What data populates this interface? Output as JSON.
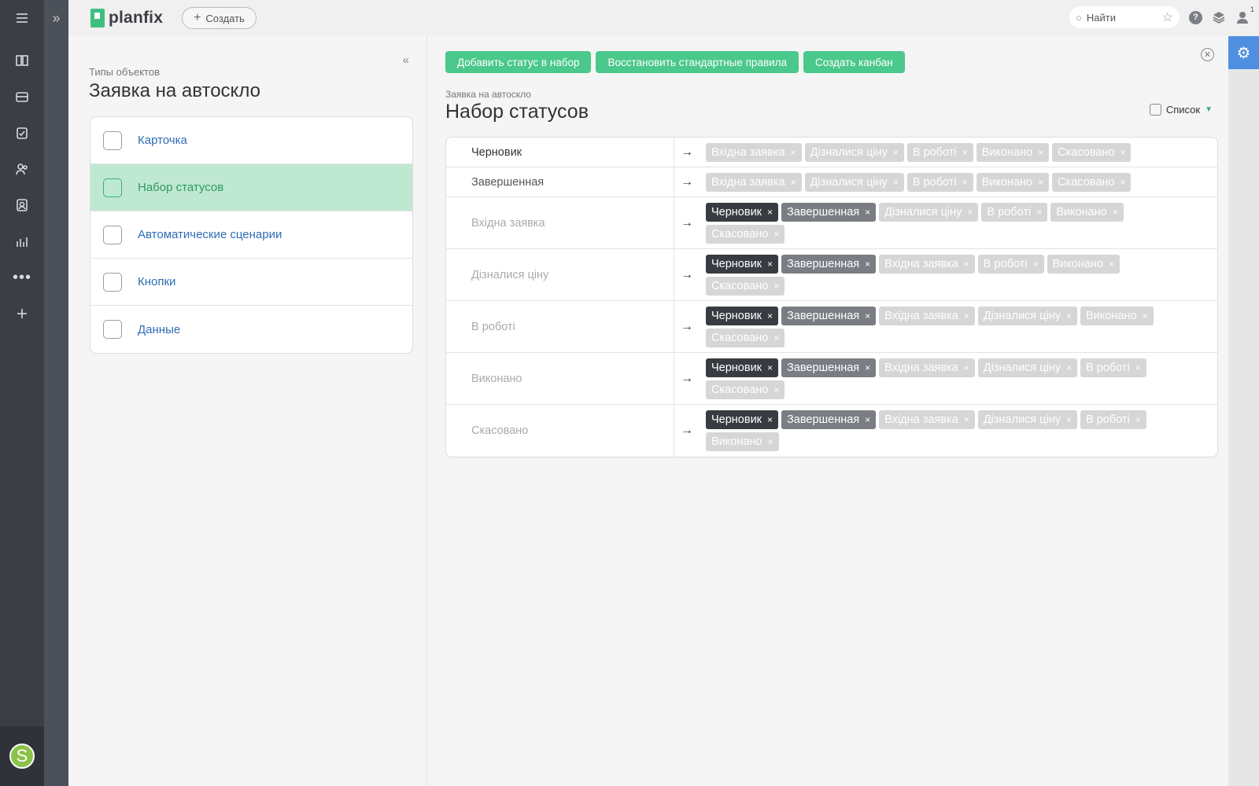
{
  "rail": {
    "items": [
      "menu-icon",
      "pages-icon",
      "inbox-icon",
      "tasks-icon",
      "contacts-icon",
      "users-icon",
      "reports-icon",
      "more-icon",
      "add-icon"
    ],
    "avatar_letter": "S"
  },
  "topbar": {
    "logo": "planfix",
    "create_label": "Создать",
    "search_placeholder": "Найти",
    "user_badge": "1"
  },
  "left": {
    "subtitle": "Типы объектов",
    "title": "Заявка на автоскло",
    "menu": [
      {
        "label": "Карточка",
        "icon": "card-icon",
        "active": false
      },
      {
        "label": "Набор статусов",
        "icon": "statuses-icon",
        "active": true
      },
      {
        "label": "Автоматические сценарии",
        "icon": "scenario-icon",
        "active": false
      },
      {
        "label": "Кнопки",
        "icon": "buttons-icon",
        "active": false
      },
      {
        "label": "Данные",
        "icon": "data-icon",
        "active": false
      }
    ]
  },
  "main": {
    "buttons": {
      "add_status": "Добавить статус в набор",
      "restore": "Восстановить стандартные правила",
      "kanban": "Создать канбан"
    },
    "subtitle": "Заявка на автоскло",
    "title": "Набор статусов",
    "view_label": "Список",
    "rows": [
      {
        "name": "Черновик",
        "tone": "dark",
        "tags": [
          {
            "label": "Вхідна заявка",
            "style": "light"
          },
          {
            "label": "Дізналися ціну",
            "style": "light"
          },
          {
            "label": "В роботі",
            "style": "light"
          },
          {
            "label": "Виконано",
            "style": "light"
          },
          {
            "label": "Скасовано",
            "style": "light"
          }
        ]
      },
      {
        "name": "Завершенная",
        "tone": "mid",
        "tags": [
          {
            "label": "Вхідна заявка",
            "style": "light"
          },
          {
            "label": "Дізналися ціну",
            "style": "light"
          },
          {
            "label": "В роботі",
            "style": "light"
          },
          {
            "label": "Виконано",
            "style": "light"
          },
          {
            "label": "Скасовано",
            "style": "light"
          }
        ]
      },
      {
        "name": "Вхідна заявка",
        "tone": "light",
        "tags": [
          {
            "label": "Черновик",
            "style": "black"
          },
          {
            "label": "Завершенная",
            "style": "grey"
          },
          {
            "label": "Дізналися ціну",
            "style": "light"
          },
          {
            "label": "В роботі",
            "style": "light"
          },
          {
            "label": "Виконано",
            "style": "light"
          },
          {
            "label": "Скасовано",
            "style": "light"
          }
        ]
      },
      {
        "name": "Дізналися ціну",
        "tone": "light",
        "tags": [
          {
            "label": "Черновик",
            "style": "black"
          },
          {
            "label": "Завершенная",
            "style": "grey"
          },
          {
            "label": "Вхідна заявка",
            "style": "light"
          },
          {
            "label": "В роботі",
            "style": "light"
          },
          {
            "label": "Виконано",
            "style": "light"
          },
          {
            "label": "Скасовано",
            "style": "light"
          }
        ]
      },
      {
        "name": "В роботі",
        "tone": "light",
        "tags": [
          {
            "label": "Черновик",
            "style": "black"
          },
          {
            "label": "Завершенная",
            "style": "grey"
          },
          {
            "label": "Вхідна заявка",
            "style": "light"
          },
          {
            "label": "Дізналися ціну",
            "style": "light"
          },
          {
            "label": "Виконано",
            "style": "light"
          },
          {
            "label": "Скасовано",
            "style": "light"
          }
        ]
      },
      {
        "name": "Виконано",
        "tone": "light",
        "tags": [
          {
            "label": "Черновик",
            "style": "black"
          },
          {
            "label": "Завершенная",
            "style": "grey"
          },
          {
            "label": "Вхідна заявка",
            "style": "light"
          },
          {
            "label": "Дізналися ціну",
            "style": "light"
          },
          {
            "label": "В роботі",
            "style": "light"
          },
          {
            "label": "Скасовано",
            "style": "light"
          }
        ]
      },
      {
        "name": "Скасовано",
        "tone": "light",
        "tags": [
          {
            "label": "Черновик",
            "style": "black"
          },
          {
            "label": "Завершенная",
            "style": "grey"
          },
          {
            "label": "Вхідна заявка",
            "style": "light"
          },
          {
            "label": "Дізналися ціну",
            "style": "light"
          },
          {
            "label": "В роботі",
            "style": "light"
          },
          {
            "label": "Виконано",
            "style": "light"
          }
        ]
      }
    ]
  },
  "colors": {
    "accent_green": "#4bc88b",
    "active_bg": "#bfe8d3",
    "rail": "#3b3e45",
    "gear_blue": "#4f8fe0"
  }
}
